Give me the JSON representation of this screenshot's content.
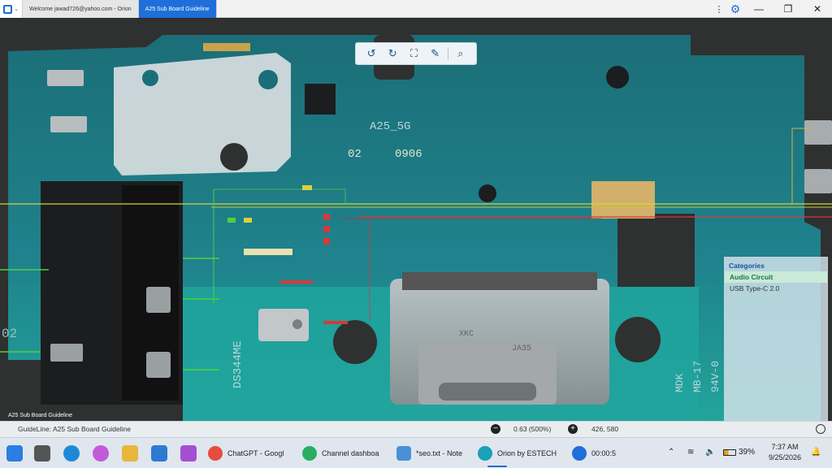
{
  "titlebar": {
    "tabs": [
      {
        "label": "Welcome jawad726@yahoo.com - Orion",
        "active": false
      },
      {
        "label": "A25 Sub Board Guideline",
        "active": true
      }
    ],
    "icons": [
      "app-menu-icon",
      "kebab-icon",
      "gear-icon",
      "minimize-icon",
      "maximize-icon",
      "close-icon"
    ]
  },
  "board": {
    "silkscreen": {
      "model": "A25_5G",
      "code_left": "02",
      "code_right": "0906",
      "chip_mark": "DS344ME",
      "edge_marks": [
        "MDK",
        "MB-17",
        "94V-0"
      ],
      "left_edge": "02",
      "usb_marks": [
        "XKC",
        "JA35"
      ]
    },
    "watermark_label": "A25 Sub Board Guideline"
  },
  "toolbar": {
    "tools": [
      "rotate-left-icon",
      "rotate-right-icon",
      "fit-screen-icon",
      "probe-icon",
      "search-icon"
    ]
  },
  "categories": {
    "title": "Categories",
    "items": [
      {
        "label": "Audio Circuit",
        "selected": true
      },
      {
        "label": "USB Type-C 2.0",
        "selected": false
      }
    ]
  },
  "statusbar": {
    "guideline": "GuideLine: A25 Sub Board Guideline",
    "zoom": "0.63 (500%)",
    "coords": "426, 580"
  },
  "taskbar": {
    "apps": [
      {
        "label": "ChatGPT - Googl",
        "color": "#e74c3c"
      },
      {
        "label": "Channel dashboa",
        "color": "#27ae60"
      },
      {
        "label": "*seo.txt - Note",
        "color": "#4a90d9"
      },
      {
        "label": "Orion by ESTECH",
        "color": "#1aa0b8"
      },
      {
        "label": "00:00:5",
        "color": "#1e6fd9"
      }
    ],
    "battery": "39%",
    "time": "7:37 AM",
    "date": "9/25/2026"
  },
  "colors": {
    "board_teal": "#1d7d86",
    "board_dark": "#146069",
    "accent_blue": "#1e6fd9",
    "trace_yellow": "#d8d23a",
    "trace_green": "#4fd13c",
    "trace_red": "#d23b3b"
  }
}
